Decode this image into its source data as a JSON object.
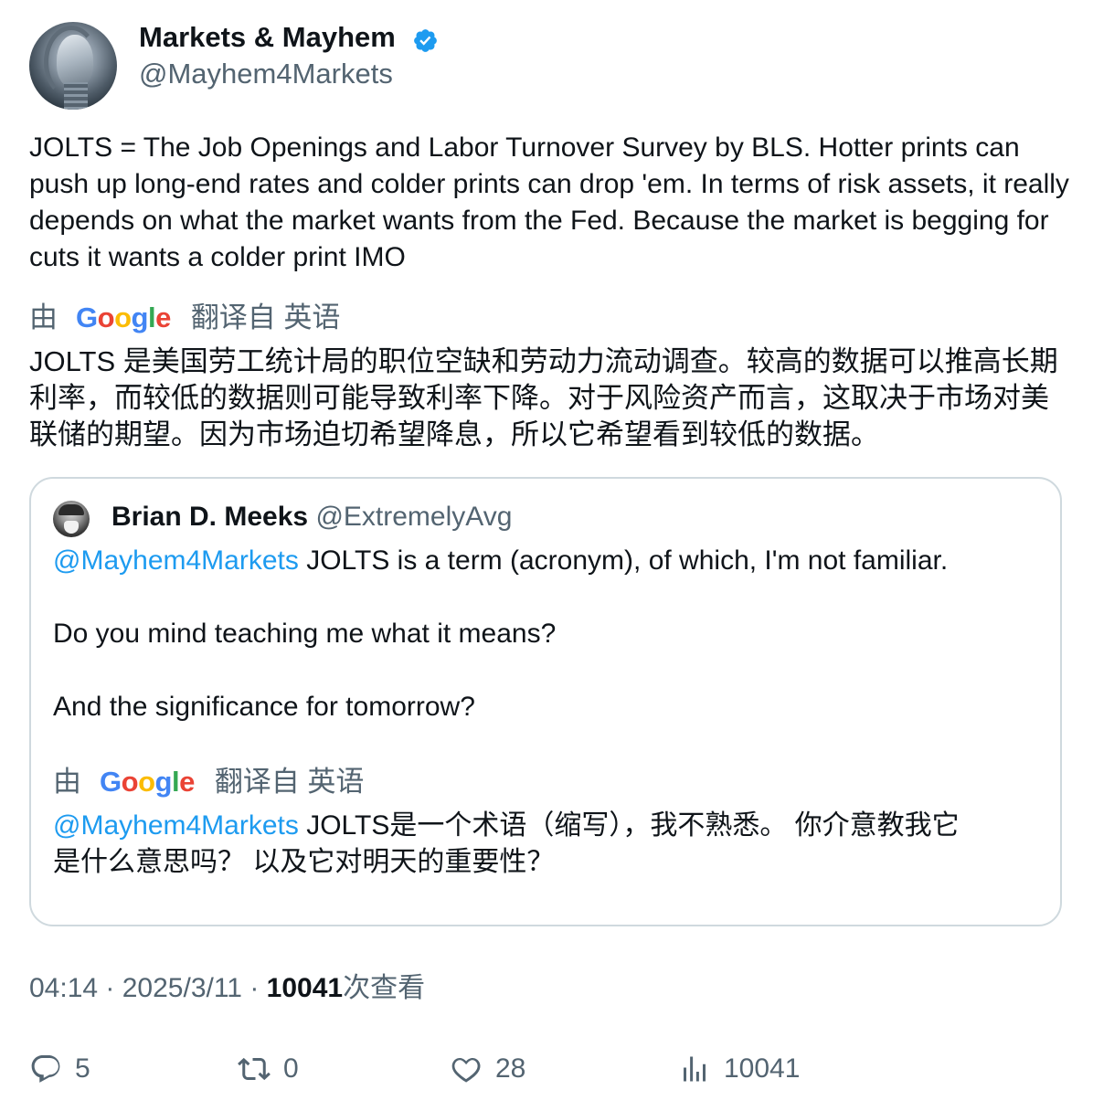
{
  "author": {
    "name": "Markets & Mayhem",
    "handle": "@Mayhem4Markets",
    "verified": true
  },
  "tweet": {
    "text": "JOLTS = The Job Openings and Labor Turnover Survey by BLS. Hotter prints can push up long-end rates and colder prints can drop 'em. In terms of risk assets, it really depends on what the market wants from the Fed. Because the market is begging for cuts it wants a colder print IMO",
    "translate_prefix": "由",
    "translate_brand": "Google",
    "translate_suffix": "翻译自 英语",
    "translation": "JOLTS 是美国劳工统计局的职位空缺和劳动力流动调查。较高的数据可以推高长期利率，而较低的数据则可能导致利率下降。对于风险资产而言，这取决于市场对美联储的期望。因为市场迫切希望降息，所以它希望看到较低的数据。"
  },
  "quoted": {
    "name": "Brian D. Meeks",
    "handle": "@ExtremelyAvg",
    "mention": "@Mayhem4Markets",
    "line1": " JOLTS is a term (acronym), of which, I'm not familiar.",
    "line2": "Do you  mind teaching me what it means?",
    "line3": "And the significance for tomorrow?",
    "translate_prefix": "由",
    "translate_brand": "Google",
    "translate_suffix": "翻译自 英语",
    "translation_mention": "@Mayhem4Markets",
    "translation_line1": " JOLTS是一个术语（缩写），我不熟悉。 你介意教我它",
    "translation_line2": "是什么意思吗？ 以及它对明天的重要性？"
  },
  "meta": {
    "time": "04:14",
    "sep1": " · ",
    "date": "2025/3/11",
    "sep2": " · ",
    "views": "10041",
    "views_label": "次查看"
  },
  "actions": {
    "replies": "5",
    "retweets": "0",
    "likes": "28",
    "views": "10041"
  },
  "colors": {
    "link": "#1d9bf0",
    "secondary_text": "#536471",
    "border": "#cfd9de"
  }
}
